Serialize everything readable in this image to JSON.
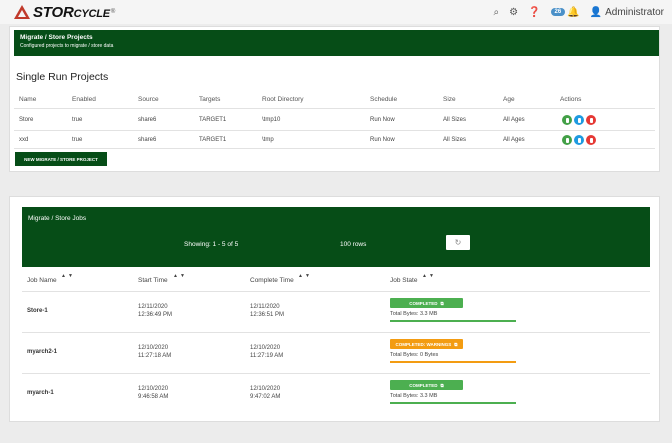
{
  "app": {
    "logo_main": "STOR",
    "logo_small": "CYCLE",
    "logo_reg": "®",
    "user": "Administrator",
    "badge": "26",
    "icons": [
      "search-icon",
      "gear-icon",
      "help-icon",
      "bell-icon",
      "user-icon"
    ]
  },
  "header": {
    "title": "Migrate / Store Projects",
    "subtitle": "Configured projects to migrate / store data"
  },
  "single_run": {
    "title": "Single Run Projects",
    "columns": [
      "Name",
      "Enabled",
      "Source",
      "Targets",
      "Root Directory",
      "Schedule",
      "Size",
      "Age",
      "Actions"
    ],
    "rows": [
      [
        "Store",
        "true",
        "share6",
        "TARGET1",
        "\\tmp10",
        "Run Now",
        "All Sizes",
        "All Ages"
      ],
      [
        "xxd",
        "true",
        "share6",
        "TARGET1",
        "\\tmp",
        "Run Now",
        "All Sizes",
        "All Ages"
      ]
    ],
    "new_button": "NEW MIGRATE / STORE PROJECT"
  },
  "jobs": {
    "title": "Migrate / Store Jobs",
    "showing": "Showing: 1 - 5 of 5",
    "rows_label": "100 rows",
    "refresh_icon": "↻",
    "sort_glyph": "▲▼",
    "external_icon": "⧉",
    "columns": [
      "Job Name",
      "Start Time",
      "Complete Time",
      "Job State"
    ],
    "rows": [
      {
        "name": "Store-1",
        "start_date": "12/11/2020",
        "start_time": "12:36:49 PM",
        "end_date": "12/11/2020",
        "end_time": "12:36:51 PM",
        "state": "COMPLETED",
        "bytes": "Total Bytes: 3.3 MB",
        "color": "#4caf50"
      },
      {
        "name": "myarch2-1",
        "start_date": "12/10/2020",
        "start_time": "11:27:18 AM",
        "end_date": "12/10/2020",
        "end_time": "11:27:19 AM",
        "state": "COMPLETED: WARNINGS",
        "bytes": "Total Bytes: 0 Bytes",
        "color": "#f39c12"
      },
      {
        "name": "myarch-1",
        "start_date": "12/10/2020",
        "start_time": "9:46:58 AM",
        "end_date": "12/10/2020",
        "end_time": "9:47:02 AM",
        "state": "COMPLETED",
        "bytes": "Total Bytes: 3.3 MB",
        "color": "#4caf50"
      }
    ]
  }
}
